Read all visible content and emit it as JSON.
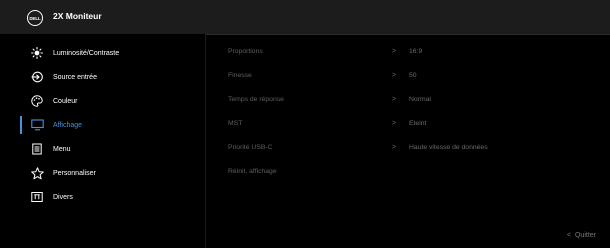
{
  "titlebar": {
    "title": "2X Moniteur",
    "logo_text": "DELL"
  },
  "menu": {
    "items": [
      {
        "label": "Luminosité/Contraste",
        "icon": "sun-icon"
      },
      {
        "label": "Source entrée",
        "icon": "input-source-icon"
      },
      {
        "label": "Couleur",
        "icon": "palette-icon"
      },
      {
        "label": "Affichage",
        "icon": "display-icon",
        "active": true
      },
      {
        "label": "Menu",
        "icon": "menu-icon"
      },
      {
        "label": "Personnaliser",
        "icon": "star-icon"
      },
      {
        "label": "Divers",
        "icon": "info-icon"
      }
    ]
  },
  "submenu": {
    "items": [
      {
        "label": "Proportions",
        "value": "16:9"
      },
      {
        "label": "Finesse",
        "value": "50"
      },
      {
        "label": "Temps de réponse",
        "value": "Normal"
      },
      {
        "label": "MST",
        "value": "Eteint"
      },
      {
        "label": "Priorité USB-C",
        "value": "Haute vitesse de données"
      },
      {
        "label": "Réinit. affichage",
        "value": ""
      }
    ],
    "chevron": ">"
  },
  "footer": {
    "quit_label": "Quitter",
    "quit_chevron": "<"
  },
  "colors": {
    "accent": "#4a90d9",
    "titlebar_bg": "#1c1c1c",
    "inactive_text": "#5f5f5f"
  }
}
